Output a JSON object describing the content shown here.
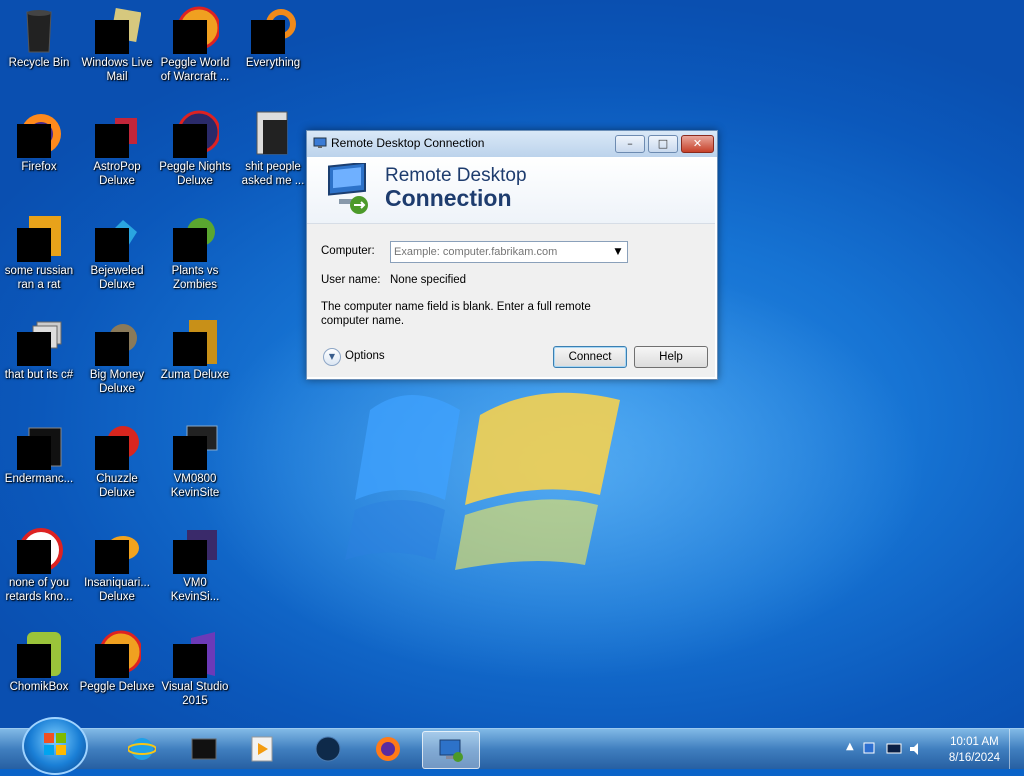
{
  "desktop": {
    "icons": [
      {
        "label": "Recycle Bin",
        "icon": "recycle-bin-icon"
      },
      {
        "label": "Windows Live\nMail",
        "icon": "windows-live-mail-icon"
      },
      {
        "label": "Peggle World\nof Warcraft ...",
        "icon": "peggle-world-of-warcraft-icon"
      },
      {
        "label": "Everything",
        "icon": "everything-icon"
      },
      {
        "label": "Firefox",
        "icon": "firefox-icon"
      },
      {
        "label": "AstroPop\nDeluxe",
        "icon": "astropop-deluxe-icon"
      },
      {
        "label": "Peggle Nights\nDeluxe",
        "icon": "peggle-nights-deluxe-icon"
      },
      {
        "label": "shit people\nasked me ...",
        "icon": "folder-icon"
      },
      {
        "label": "some russian\nran a rat",
        "icon": "app-icon"
      },
      {
        "label": "Bejeweled\nDeluxe",
        "icon": "bejeweled-deluxe-icon"
      },
      {
        "label": "Plants vs\nZombies",
        "icon": "plants-vs-zombies-icon"
      },
      {
        "label": "that but its c#",
        "icon": "app-icon"
      },
      {
        "label": "Big Money\nDeluxe",
        "icon": "big-money-deluxe-icon"
      },
      {
        "label": "Zuma Deluxe",
        "icon": "zuma-deluxe-icon"
      },
      {
        "label": "Endermanc...",
        "icon": "app-icon"
      },
      {
        "label": "Chuzzle\nDeluxe",
        "icon": "chuzzle-deluxe-icon"
      },
      {
        "label": "VM0800\nKevinSite",
        "icon": "vm-icon"
      },
      {
        "label": "none of you\nretards kno...",
        "icon": "app-icon"
      },
      {
        "label": "Insaniquari...\nDeluxe",
        "icon": "insaniquarium-deluxe-icon"
      },
      {
        "label": "VM0\nKevinSi...",
        "icon": "vm-icon"
      },
      {
        "label": "ChomikBox",
        "icon": "chomikbox-icon"
      },
      {
        "label": "Peggle Deluxe",
        "icon": "peggle-deluxe-icon"
      },
      {
        "label": "Visual Studio\n2015",
        "icon": "visual-studio-icon"
      }
    ]
  },
  "rdc": {
    "window_title": "Remote Desktop Connection",
    "header_line1": "Remote Desktop",
    "header_line2": "Connection",
    "computer_label": "Computer:",
    "computer_placeholder": "Example: computer.fabrikam.com",
    "computer_value": "",
    "username_label": "User name:",
    "username_value": "None specified",
    "message": "The computer name field is blank. Enter a full remote computer name.",
    "options_label": "Options",
    "connect_label": "Connect",
    "help_label": "Help"
  },
  "taskbar": {
    "pinned": [
      "internet-explorer-icon",
      "terminal-icon",
      "media-player-icon",
      "globe-icon",
      "firefox-icon",
      "remote-desktop-icon"
    ],
    "active": "remote-desktop-icon",
    "clock_time": "10:01 AM",
    "clock_date": "8/16/2024"
  },
  "colors": {
    "desktop_blue": "#1673d3",
    "window_title_text": "#1e3c6e",
    "close_red": "#c6412a"
  }
}
